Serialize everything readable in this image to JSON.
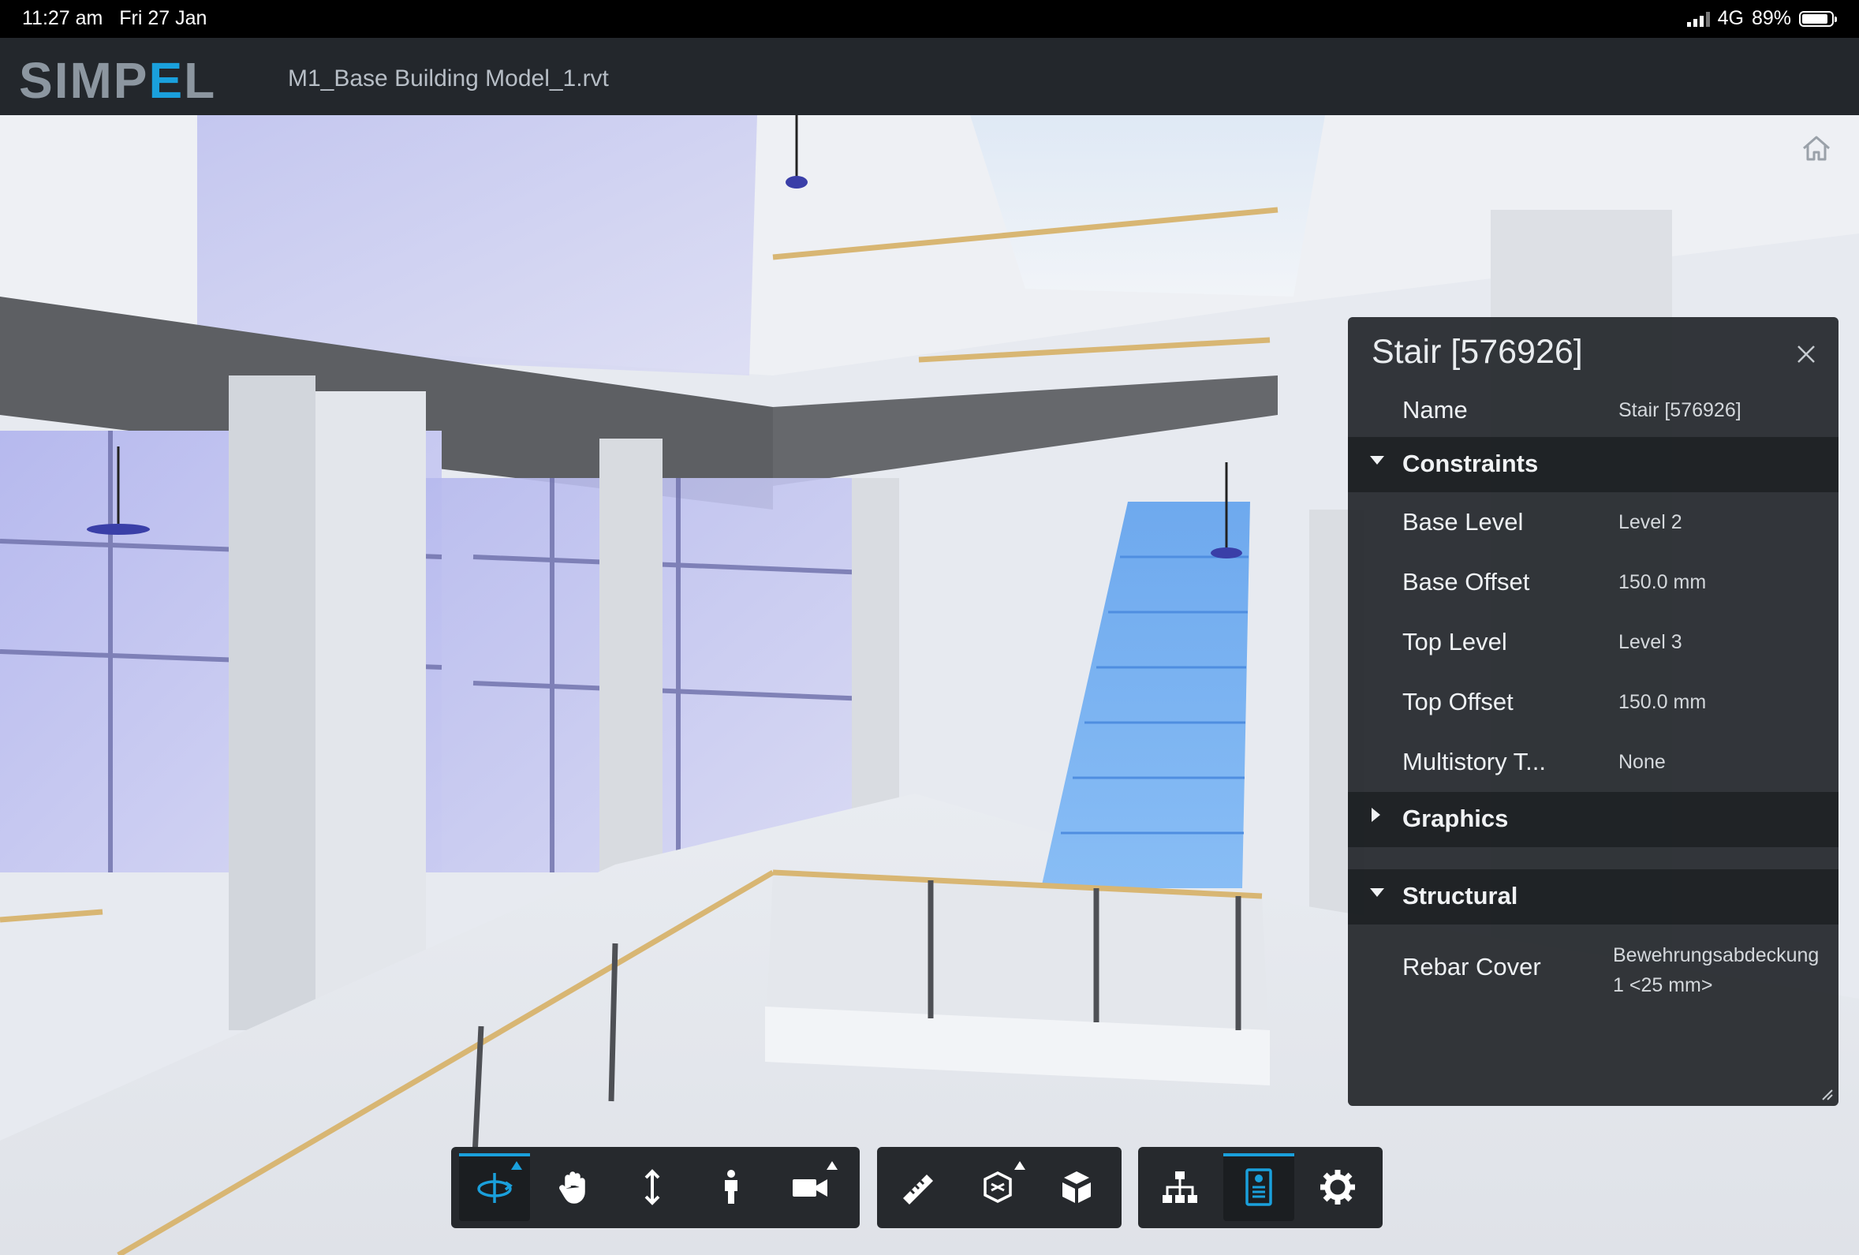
{
  "status_bar": {
    "time": "11:27 am",
    "date": "Fri 27 Jan",
    "network": "4G",
    "battery": "89%",
    "battery_level": 0.89
  },
  "app": {
    "logo_prefix": "SIMP",
    "logo_accent": "E",
    "logo_suffix": "L",
    "file_name": "M1_Base Building Model_1.rvt",
    "accent_color": "#1aa0dc"
  },
  "properties_panel": {
    "title": "Stair [576926]",
    "close_icon": "close-icon",
    "name_row": {
      "label": "Name",
      "value": "Stair [576926]"
    },
    "sections": [
      {
        "title": "Constraints",
        "expanded": true,
        "rows": [
          {
            "label": "Base Level",
            "value": "Level 2"
          },
          {
            "label": "Base Offset",
            "value": "150.0 mm"
          },
          {
            "label": "Top Level",
            "value": "Level 3"
          },
          {
            "label": "Top Offset",
            "value": "150.0 mm"
          },
          {
            "label": "Multistory T...",
            "value": "None"
          }
        ]
      },
      {
        "title": "Graphics",
        "expanded": false,
        "rows": []
      },
      {
        "title": "Structural",
        "expanded": true,
        "rows": [
          {
            "label": "Rebar Cover",
            "value_line1": "Bewehrungsabdeckung",
            "value_line2": "1 <25 mm>"
          }
        ]
      }
    ]
  },
  "toolbar": {
    "groups": [
      {
        "tools": [
          "orbit-icon",
          "pan-icon",
          "zoom-icon",
          "first-person-icon",
          "camera-icon"
        ]
      },
      {
        "tools": [
          "measure-icon",
          "section-icon",
          "explode-icon"
        ]
      },
      {
        "tools": [
          "model-browser-icon",
          "properties-icon",
          "settings-icon"
        ]
      }
    ],
    "active_tools": [
      "orbit-icon",
      "properties-icon"
    ]
  }
}
